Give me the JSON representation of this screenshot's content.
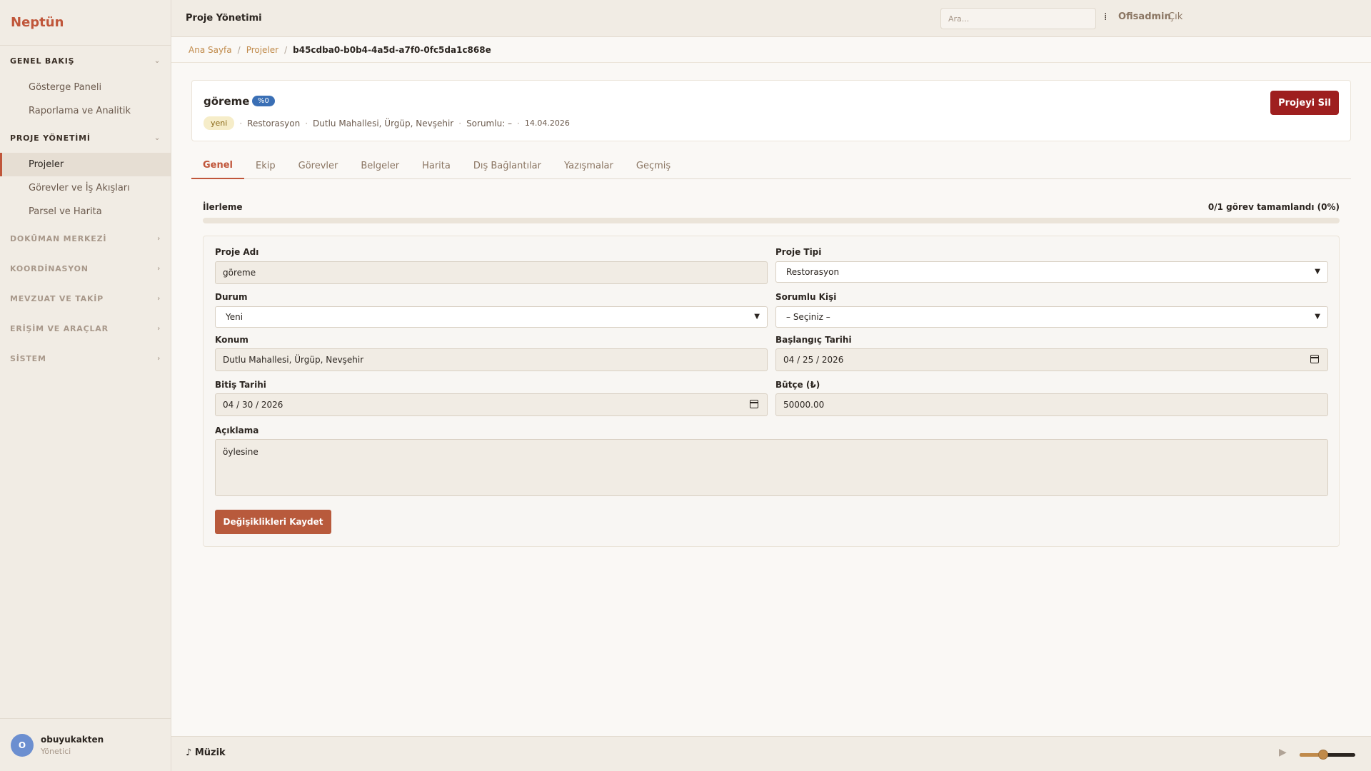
{
  "app": {
    "brand": "Neptün"
  },
  "sidebar": {
    "sections": [
      {
        "label": "GENEL BAKIŞ",
        "open": true,
        "items": [
          "Gösterge Paneli",
          "Raporlama ve Analitik"
        ]
      },
      {
        "label": "PROJE YÖNETİMİ",
        "open": true,
        "items": [
          "Projeler",
          "Görevler ve İş Akışları",
          "Parsel ve Harita"
        ]
      },
      {
        "label": "DOKÜMAN MERKEZİ",
        "open": false
      },
      {
        "label": "KOORDİNASYON",
        "open": false
      },
      {
        "label": "MEVZUAT VE TAKİP",
        "open": false
      },
      {
        "label": "ERİŞİM VE ARAÇLAR",
        "open": false
      },
      {
        "label": "SİSTEM",
        "open": false
      }
    ],
    "active_item": "Projeler",
    "user": {
      "initial": "O",
      "name": "obuyukakten",
      "role": "Yönetici"
    }
  },
  "topbar": {
    "title": "Proje Yönetimi",
    "search_placeholder": "Ara...",
    "user_label": "Ofisadmin",
    "exit_label": "Çık"
  },
  "breadcrumb": {
    "home": "Ana Sayfa",
    "projects": "Projeler",
    "current": "b45cdba0-b0b4-4a5d-a7f0-0fc5da1c868e",
    "separator": "/"
  },
  "project": {
    "name": "göreme",
    "percent_badge": "%0",
    "status": "yeni",
    "type": "Restorasyon",
    "location": "Dutlu Mahallesi, Ürgüp, Nevşehir",
    "responsible": "Sorumlu: –",
    "date": "14.04.2026",
    "delete_label": "Projeyi Sil"
  },
  "tabs": [
    "Genel",
    "Ekip",
    "Görevler",
    "Belgeler",
    "Harita",
    "Dış Bağlantılar",
    "Yazışmalar",
    "Geçmiş"
  ],
  "active_tab": "Genel",
  "progress": {
    "label": "İlerleme",
    "text": "0/1 görev tamamlandı (0%)",
    "value": 0
  },
  "form": {
    "name_label": "Proje Adı",
    "name_value": "göreme",
    "type_label": "Proje Tipi",
    "type_value": "Restorasyon",
    "status_label": "Durum",
    "status_value": "Yeni",
    "resp_label": "Sorumlu Kişi",
    "resp_value": "– Seçiniz –",
    "location_label": "Konum",
    "location_value": "Dutlu Mahallesi, Ürgüp, Nevşehir",
    "start_label": "Başlangıç Tarihi",
    "start_value": "04 / 25 / 2026",
    "end_label": "Bitiş Tarihi",
    "end_value": "04 / 30 / 2026",
    "budget_label": "Bütçe (₺)",
    "budget_value": "50000.00",
    "desc_label": "Açıklama",
    "desc_value": "öylesine",
    "save_label": "Değişiklikleri Kaydet"
  },
  "music": {
    "label": "♪ Müzik",
    "volume": 0.42
  },
  "colors": {
    "accent": "#c0563a",
    "danger": "#9e1f1f",
    "badge": "#3a6fb5"
  }
}
